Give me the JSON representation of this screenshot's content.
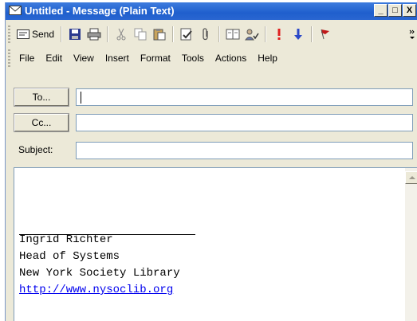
{
  "window": {
    "title": "Untitled - Message (Plain Text)",
    "controls": {
      "minimize": "_",
      "maximize": "□",
      "close": "X"
    }
  },
  "toolbar": {
    "send_label": "Send",
    "icons": [
      "send-icon",
      "save-icon",
      "print-icon",
      "cut-icon",
      "copy-icon",
      "paste-icon",
      "check-names-icon",
      "attach-file-icon",
      "address-book-icon",
      "options-icon",
      "high-importance-icon",
      "low-importance-icon",
      "follow-up-flag-icon",
      "toolbar-options-icon"
    ]
  },
  "menu": {
    "items": [
      "File",
      "Edit",
      "View",
      "Insert",
      "Format",
      "Tools",
      "Actions",
      "Help"
    ]
  },
  "header": {
    "to_button": "To...",
    "cc_button": "Cc...",
    "subject_label": "Subject:",
    "to_value": "",
    "cc_value": "",
    "subject_value": ""
  },
  "body": {
    "signature_name": "Ingrid Richter",
    "signature_title": "Head of Systems",
    "signature_org": "New York Society Library",
    "signature_url": "http://www.nysoclib.org"
  },
  "colors": {
    "titlebar": "#2a66d1",
    "chrome": "#ece9d8",
    "link": "#0000ee",
    "importance": "#e02020"
  }
}
